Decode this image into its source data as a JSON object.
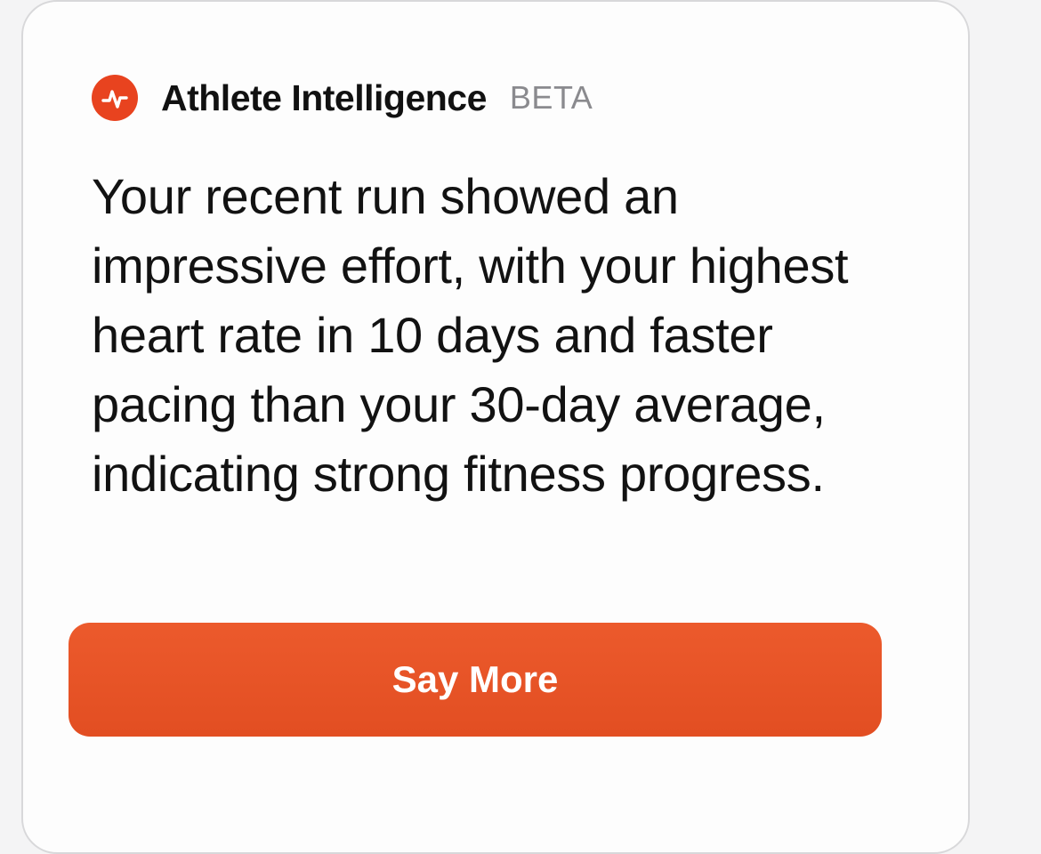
{
  "card": {
    "app_title": "Athlete Intelligence",
    "badge": "BETA",
    "logo_icon": "strava-pulse-icon",
    "message": "Your recent run showed an impressive effort, with your highest heart rate in 10 days and faster pacing than your 30-day average, indicating strong fitness progress.",
    "action_label": "Say More"
  },
  "colors": {
    "accent": "#e8431f",
    "button": "#e8552a",
    "badge_text": "#8a8a8e",
    "text": "#121212"
  }
}
